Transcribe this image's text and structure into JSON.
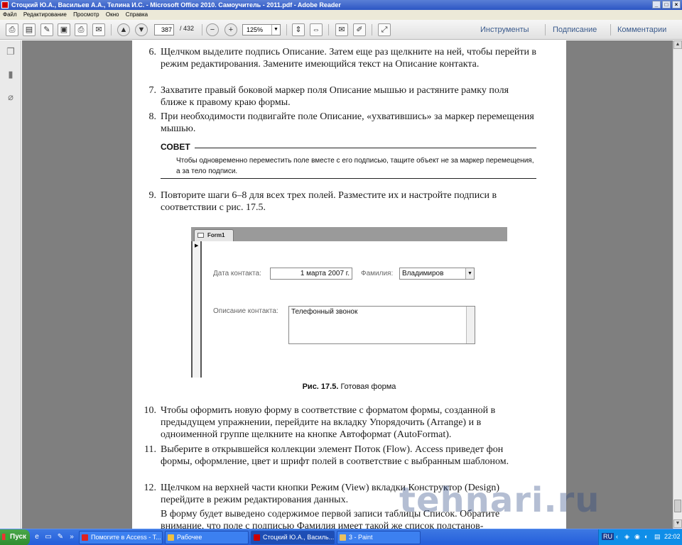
{
  "window": {
    "title": "Стоцкий Ю.А., Васильев А.А., Телина И.С. - Microsoft Office 2010. Самоучитель - 2011.pdf - Adobe Reader"
  },
  "menu": [
    "Файл",
    "Редактирование",
    "Просмотр",
    "Окно",
    "Справка"
  ],
  "toolbar": {
    "page_current": "387",
    "page_total": "/ 432",
    "zoom": "125%",
    "tools": "Инструменты",
    "sign": "Подписание",
    "comments": "Комментарии"
  },
  "doc": {
    "items_top": [
      {
        "num": "6.",
        "text": "Щелчком выделите подпись Описание. Затем еще раз щелкните на ней, чтобы перейти в режим редактирования. Замените имеющийся текст на Описание контакта."
      },
      {
        "num": "7.",
        "text": "Захватите правый боковой маркер поля Описание мышью и растяните рамку поля ближе к правому краю формы."
      },
      {
        "num": "8.",
        "text": "При необходимости подвигайте поле Описание, «ухватившись» за маркер перемещения мышью."
      }
    ],
    "sovet_title": "СОВЕТ",
    "sovet_text": "Чтобы одновременно переместить поле вместе с его подписью, тащите объект не за маркер перемещения, а за тело подписи.",
    "item9": {
      "num": "9.",
      "text": "Повторите шаги 6–8 для всех трех полей. Разместите их и настройте подписи в соответствии с рис. 17.5."
    },
    "figure": {
      "tab": "Form1",
      "date_label": "Дата контакта:",
      "date_value": "1 марта 2007 г.",
      "surname_label": "Фамилия:",
      "surname_value": "Владимиров",
      "desc_label": "Описание контакта:",
      "desc_value": "Телефонный звонок"
    },
    "caption_bold": "Рис. 17.5.",
    "caption_text": "Готовая форма",
    "items_bottom": [
      {
        "num": "10.",
        "text": "Чтобы оформить новую форму в соответствие с форматом формы, созданной в предыдущем упражнении, перейдите на вкладку Упорядочить (Arrange) и в одноименной группе щелкните на кнопке Автоформат (AutoFormat)."
      },
      {
        "num": "11.",
        "text": "Выберите в открывшейся коллекции элемент Поток (Flow). Access приведет фон формы, оформление, цвет и шрифт полей в соответствие с выбранным шаблоном."
      },
      {
        "num": "12.",
        "text": "Щелчком на верхней части кнопки Режим (View) вкладки Конструктор (Design) перейдите в режим редактирования данных."
      }
    ],
    "para": "В форму будет выведено содержимое первой записи таблицы Список. Обратите внимание, что поле с подписью Фамилия имеет такой же список подстанов-",
    "watermark": "tehnari.ru"
  },
  "taskbar": {
    "start": "Пуск",
    "tasks": [
      "Помогите в Access - T...",
      "Рабочее",
      "Стоцкий Ю.А., Василь...",
      "3 - Paint"
    ],
    "lang": "RU",
    "time": "22:02"
  }
}
